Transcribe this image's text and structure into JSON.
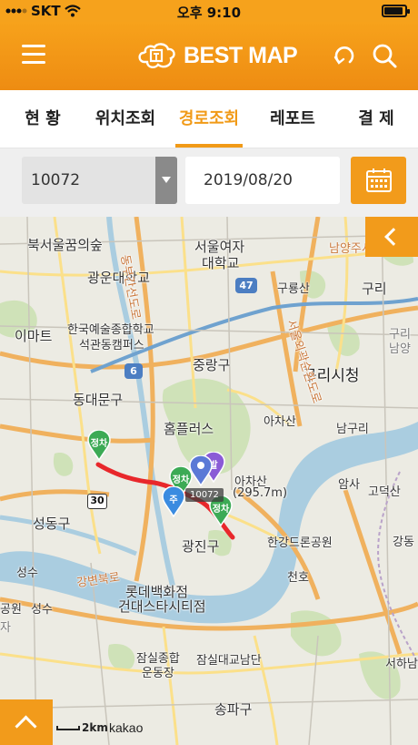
{
  "status_bar": {
    "carrier": "SKT",
    "time": "오후 9:10"
  },
  "header": {
    "brand": "BEST MAP",
    "icons": [
      "hamburger-icon",
      "logo-icon",
      "refresh-icon",
      "search-icon"
    ]
  },
  "tabs": [
    {
      "label": "현 황",
      "active": false
    },
    {
      "label": "위치조회",
      "active": false
    },
    {
      "label": "경로조회",
      "active": true
    },
    {
      "label": "레포트",
      "active": false
    },
    {
      "label": "결 제",
      "active": false
    }
  ],
  "filter": {
    "device_id": "10072",
    "date": "2019/08/20"
  },
  "map": {
    "labels": {
      "l1": "북서울꿈의숲",
      "l2": "서울여자",
      "l2b": "대학교",
      "l3": "남양주시",
      "l4": "광운대학교",
      "l5": "구룡산",
      "l6": "구리",
      "l7": "이마트",
      "l8": "한국예술종합학교",
      "l8b": "석관동캠퍼스",
      "l9": "구리시청",
      "l10": "중랑구",
      "l11": "동대문구",
      "l12": "홈플러스",
      "l13": "아차산",
      "l14": "남구리",
      "l15": "아차산",
      "l15b": "(295.7m)",
      "l16": "암사",
      "l17": "고덕산",
      "l18": "성동구",
      "l19": "광진구",
      "l20": "한강드론공원",
      "l21": "강동",
      "l22": "성수",
      "l23": "천호",
      "l24": "롯데백화점",
      "l24b": "건대스타시티점",
      "l25": "성수",
      "l26": "공원",
      "l27": "잠실종합",
      "l27b": "운동장",
      "l28": "잠실대교남단",
      "l29": "송파구",
      "l30": "서하남",
      "l31": "강변북로",
      "l32": "동부간선도로",
      "l33": "서울외곽순환도로",
      "l34": "남양",
      "l35": "구리",
      "l36": "자"
    },
    "road_numbers": [
      "47",
      "6",
      "30"
    ],
    "pins": [
      {
        "text": "정차",
        "color": "#3caa55"
      },
      {
        "text": "정차",
        "color": "#3caa55"
      },
      {
        "text": "주",
        "color": "#3a8be0"
      },
      {
        "text": "발",
        "color": "#8a5bd6"
      },
      {
        "text": "정차",
        "color": "#3caa55"
      }
    ],
    "device_label": "10072",
    "scale": "2km",
    "attribution": "kakao",
    "route_color": "#e8272b"
  }
}
